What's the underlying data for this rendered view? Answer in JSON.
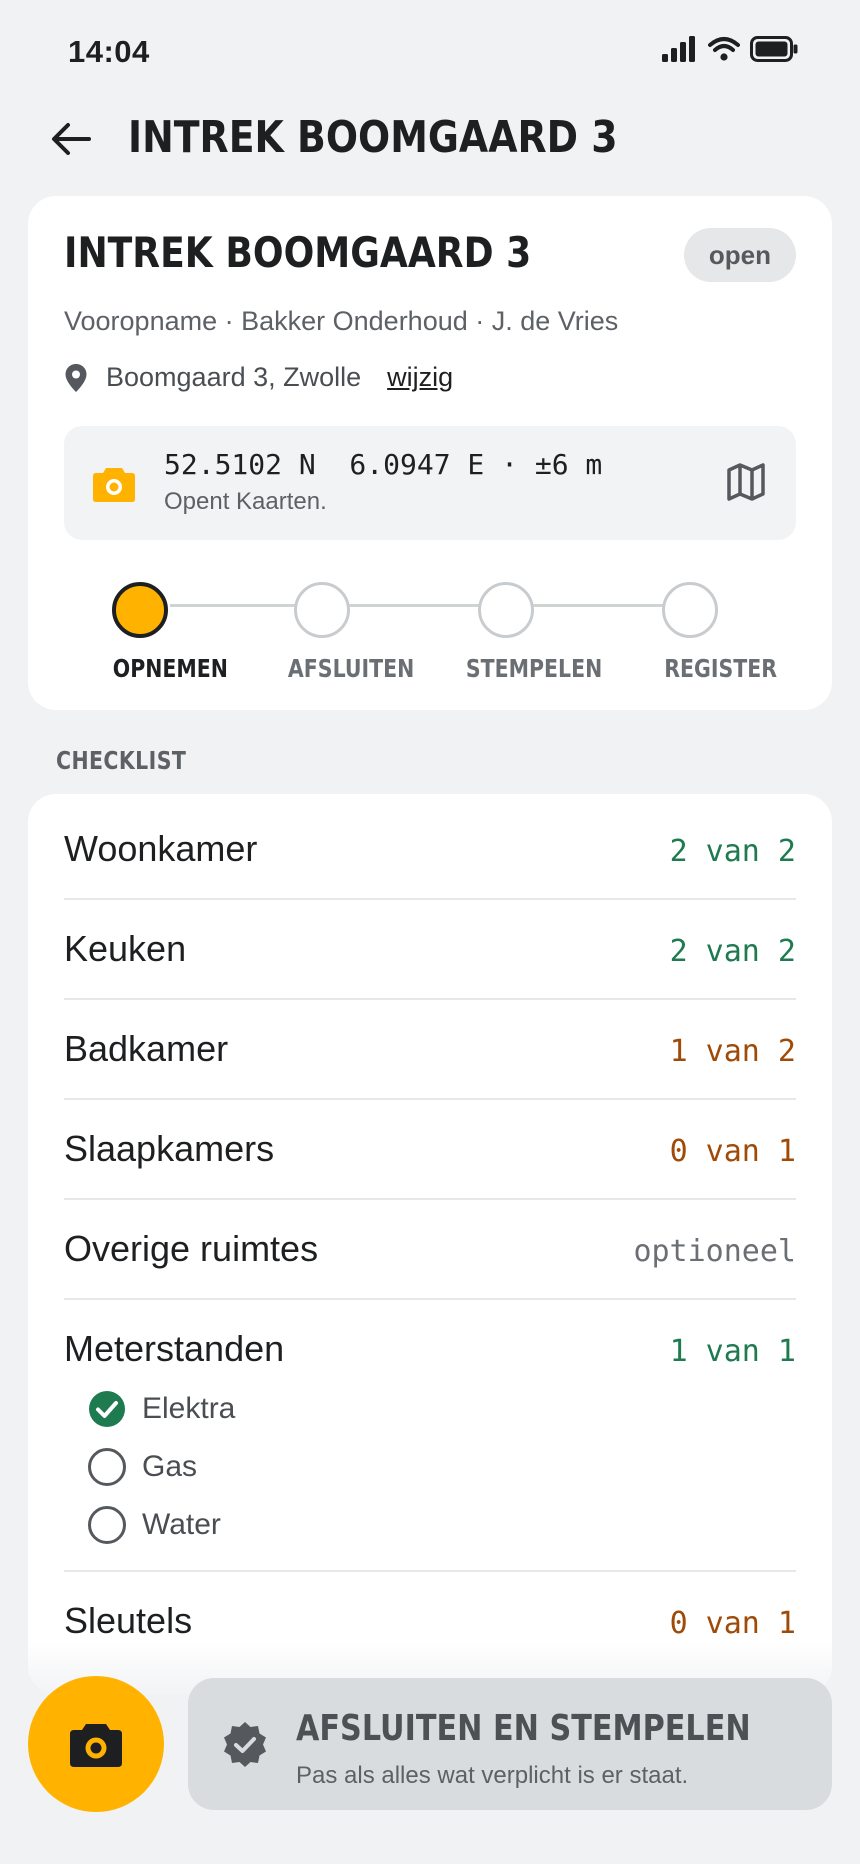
{
  "status_bar": {
    "time": "14:04"
  },
  "header": {
    "title": "INTREK BOOMGAARD 3"
  },
  "inspection": {
    "title": "INTREK BOOMGAARD 3",
    "status_badge": "open",
    "meta": "Vooropname · Bakker Onderhoud · J. de Vries",
    "address": "Boomgaard 3, Zwolle",
    "edit_link": "wijzig",
    "gps": {
      "coords": "52.5102 N  6.0947 E · ±6 m",
      "hint": "Opent Kaarten."
    }
  },
  "stepper": {
    "steps": [
      {
        "label": "OPNEMEN",
        "state": "active"
      },
      {
        "label": "AFSLUITEN",
        "state": "pending"
      },
      {
        "label": "STEMPELEN",
        "state": "pending"
      },
      {
        "label": "REGISTER",
        "state": "pending"
      }
    ]
  },
  "checklist": {
    "section_label": "CHECKLIST",
    "rows": [
      {
        "name": "Woonkamer",
        "status": "2 van 2",
        "tone": "complete"
      },
      {
        "name": "Keuken",
        "status": "2 van 2",
        "tone": "complete"
      },
      {
        "name": "Badkamer",
        "status": "1 van 2",
        "tone": "incomplete"
      },
      {
        "name": "Slaapkamers",
        "status": "0 van 1",
        "tone": "incomplete"
      },
      {
        "name": "Overige ruimtes",
        "status": "optioneel",
        "tone": "optional"
      },
      {
        "name": "Meterstanden",
        "status": "1 van 1",
        "tone": "complete",
        "subitems": [
          {
            "label": "Elektra",
            "checked": true
          },
          {
            "label": "Gas",
            "checked": false
          },
          {
            "label": "Water",
            "checked": false
          }
        ]
      },
      {
        "name": "Sleutels",
        "status": "0 van 1",
        "tone": "incomplete"
      }
    ]
  },
  "footer": {
    "cta_title": "AFSLUITEN EN STEMPELEN",
    "cta_subtitle": "Pas als alles wat verplicht is er staat."
  },
  "colors": {
    "accent": "#ffb300",
    "complete": "#1e7a4f",
    "incomplete": "#a04a07",
    "background": "#f1f2f4"
  },
  "icons": {
    "back": "arrow-left-icon",
    "location": "location-pin-icon",
    "camera": "camera-icon",
    "map": "map-icon",
    "checked": "check-circle-icon",
    "seal": "verified-seal-icon"
  }
}
